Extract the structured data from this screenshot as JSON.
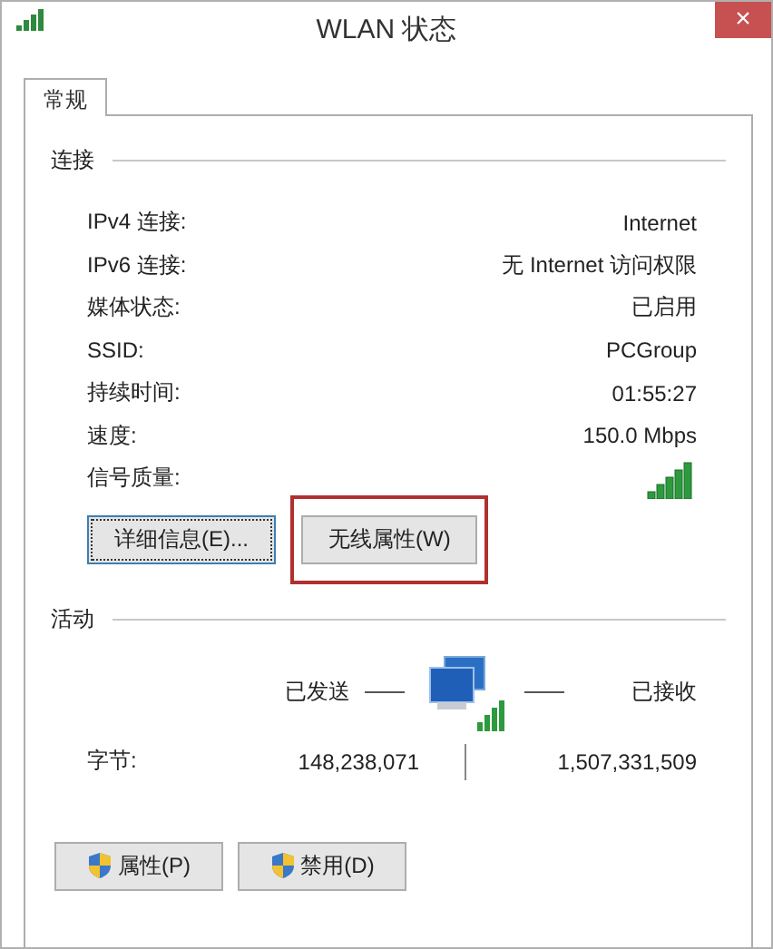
{
  "window": {
    "title": "WLAN 状态",
    "close": "×"
  },
  "tabs": [
    {
      "label": "常规",
      "selected": true
    }
  ],
  "connection": {
    "heading": "连接",
    "rows": [
      {
        "label": "IPv4 连接:",
        "value": "Internet",
        "kind": "text"
      },
      {
        "label": "IPv6 连接:",
        "value": "无 Internet 访问权限",
        "kind": "text"
      },
      {
        "label": "媒体状态:",
        "value": "已启用",
        "kind": "text"
      },
      {
        "label": "SSID:",
        "value": "PCGroup",
        "kind": "text"
      },
      {
        "label": "持续时间:",
        "value": "01:55:27",
        "kind": "text"
      },
      {
        "label": "速度:",
        "value": "150.0 Mbps",
        "kind": "text"
      },
      {
        "label": "信号质量:",
        "kind": "signal"
      }
    ],
    "buttons": [
      {
        "label": "详细信息(E)...",
        "focused": true,
        "highlighted": false
      },
      {
        "label": "无线属性(W)",
        "focused": false,
        "highlighted": true
      }
    ]
  },
  "activity": {
    "heading": "活动",
    "sent_label": "已发送",
    "received_label": "已接收",
    "bytes_label": "字节:",
    "sent": "148,238,071",
    "received": "1,507,331,509"
  },
  "bottom_buttons": [
    {
      "label": "属性(P)",
      "shield": true
    },
    {
      "label": "禁用(D)",
      "shield": true
    }
  ]
}
